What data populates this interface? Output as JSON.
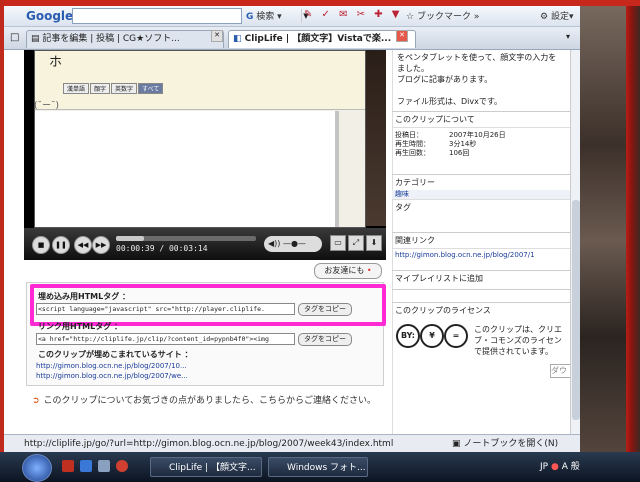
{
  "toolbar": {
    "logo": "Google",
    "search_btn": "検索",
    "bookmark": "ブックマーク",
    "settings": "設定"
  },
  "tabs": [
    {
      "label": "記事を編集 | 投稿 | CG★ソフト..."
    },
    {
      "label": "ClipLife | 【顔文字】Vistaで楽..."
    }
  ],
  "player": {
    "kaomoji": "(˘ー˘)",
    "mini_tabs": [
      "漢単語",
      "顔字",
      "英数字",
      "すべて"
    ],
    "char": "ホ",
    "time": "00:00:39 / 00:03:14",
    "progress": 0.2
  },
  "friend_button": "お友達にも",
  "embed": {
    "label1": "埋め込み用HTMLタグ ：",
    "code1": "<script language=\"javascript\" src=\"http://player.cliplife.",
    "copy_btn": "タグをコピー",
    "label2": "リンク用HTMLタグ ：",
    "code2": "<a href=\"http://cliplife.jp/clip/?content_id=pypnb4f0\"><img",
    "label3": "このクリップが埋めこまれているサイト ：",
    "sites": [
      "http://gimon.blog.ocn.ne.jp/blog/2007/10...",
      "http://gimon.blog.ocn.ne.jp/blog/2007/we..."
    ]
  },
  "report": "このクリップについてお気づきの点がありましたら、こちらからご連絡ください。",
  "sidebar": {
    "desc_lines": [
      "をペンタブレットを使って、顔文字の入力を",
      "ました。",
      "ブログに記事があります。",
      "",
      "ファイル形式は、Divxです。"
    ],
    "about_title": "このクリップについて",
    "posted_label": "投稿日：",
    "posted": "2007年10月26日",
    "duration_label": "再生時間：",
    "duration": "3分14秒",
    "plays_label": "再生回数：",
    "plays": "106回",
    "category_title": "カテゴリー",
    "category": "趣味",
    "tag_title": "タグ",
    "related_title": "関連リンク",
    "related_link": "http://gimon.blog.ocn.ne.jp/blog/2007/1",
    "mylist": "マイプレイリストに追加",
    "license_title": "このクリップのライセンス",
    "license_text": [
      "このクリップは、クリエ",
      "ブ・コモンズのライセン",
      "で提供されています。"
    ],
    "download": "ダウ"
  },
  "status": {
    "url": "http://cliplife.jp/go/?url=http://gimon.blog.ocn.ne.jp/blog/2007/week43/index.html",
    "notebook": "ノートブックを開く(N)"
  },
  "taskbar": {
    "items": [
      "ClipLife | 【顔文字...",
      "Windows フォト..."
    ],
    "lang": "JP",
    "ime": "A 般"
  }
}
